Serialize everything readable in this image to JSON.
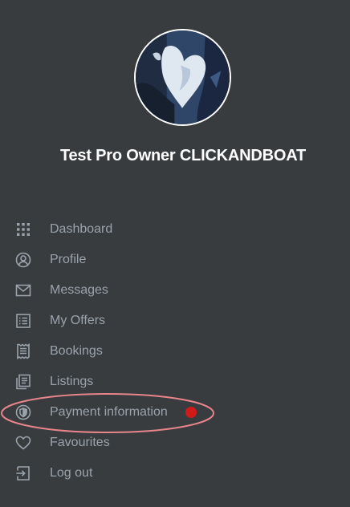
{
  "user": {
    "name": "Test Pro Owner CLICKANDBOAT"
  },
  "colors": {
    "background": "#393c3f",
    "menu_text": "#9aa2ab",
    "name_text": "#ffffff",
    "alert_dot": "#d11a1a",
    "highlight": "#e8858b"
  },
  "menu": {
    "items": [
      {
        "label": "Dashboard",
        "icon": "grid-icon"
      },
      {
        "label": "Profile",
        "icon": "user-circle-icon"
      },
      {
        "label": "Messages",
        "icon": "envelope-icon"
      },
      {
        "label": "My Offers",
        "icon": "list-icon"
      },
      {
        "label": "Bookings",
        "icon": "receipt-icon"
      },
      {
        "label": "Listings",
        "icon": "documents-icon"
      },
      {
        "label": "Payment information",
        "icon": "shield-icon",
        "alert": true
      },
      {
        "label": "Favourites",
        "icon": "heart-icon"
      },
      {
        "label": "Log out",
        "icon": "logout-icon"
      }
    ]
  }
}
